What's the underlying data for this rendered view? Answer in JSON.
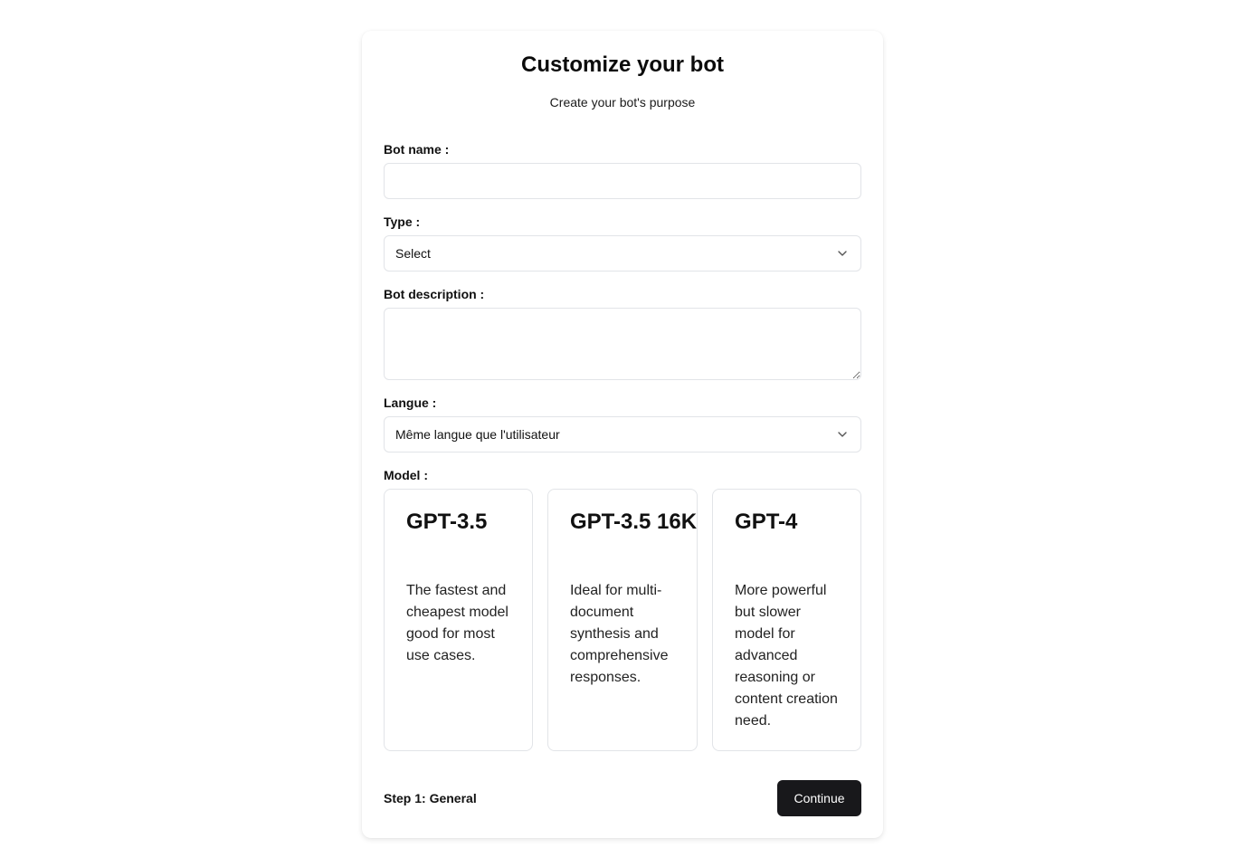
{
  "header": {
    "title": "Customize your bot",
    "subtitle": "Create your bot's purpose"
  },
  "form": {
    "bot_name": {
      "label": "Bot name :",
      "value": "",
      "placeholder": ""
    },
    "type": {
      "label": "Type :",
      "selected": "Select",
      "icon": "chevron-down-icon"
    },
    "description": {
      "label": "Bot description :",
      "value": "",
      "placeholder": ""
    },
    "language": {
      "label": "Langue :",
      "selected": "Même langue que l'utilisateur",
      "icon": "chevron-down-icon"
    },
    "model": {
      "label": "Model :",
      "options": [
        {
          "name": "GPT-3.5",
          "description": "The fastest and cheapest model good for most use cases."
        },
        {
          "name": "GPT-3.5 16K",
          "description": "Ideal for multi-document synthesis and comprehensive responses."
        },
        {
          "name": "GPT-4",
          "description": "More powerful but slower model for advanced reasoning or content creation need."
        }
      ]
    }
  },
  "footer": {
    "step": "Step 1: General",
    "continue_label": "Continue"
  },
  "colors": {
    "primary_button": "#18181b",
    "border": "#e2e4e8"
  }
}
